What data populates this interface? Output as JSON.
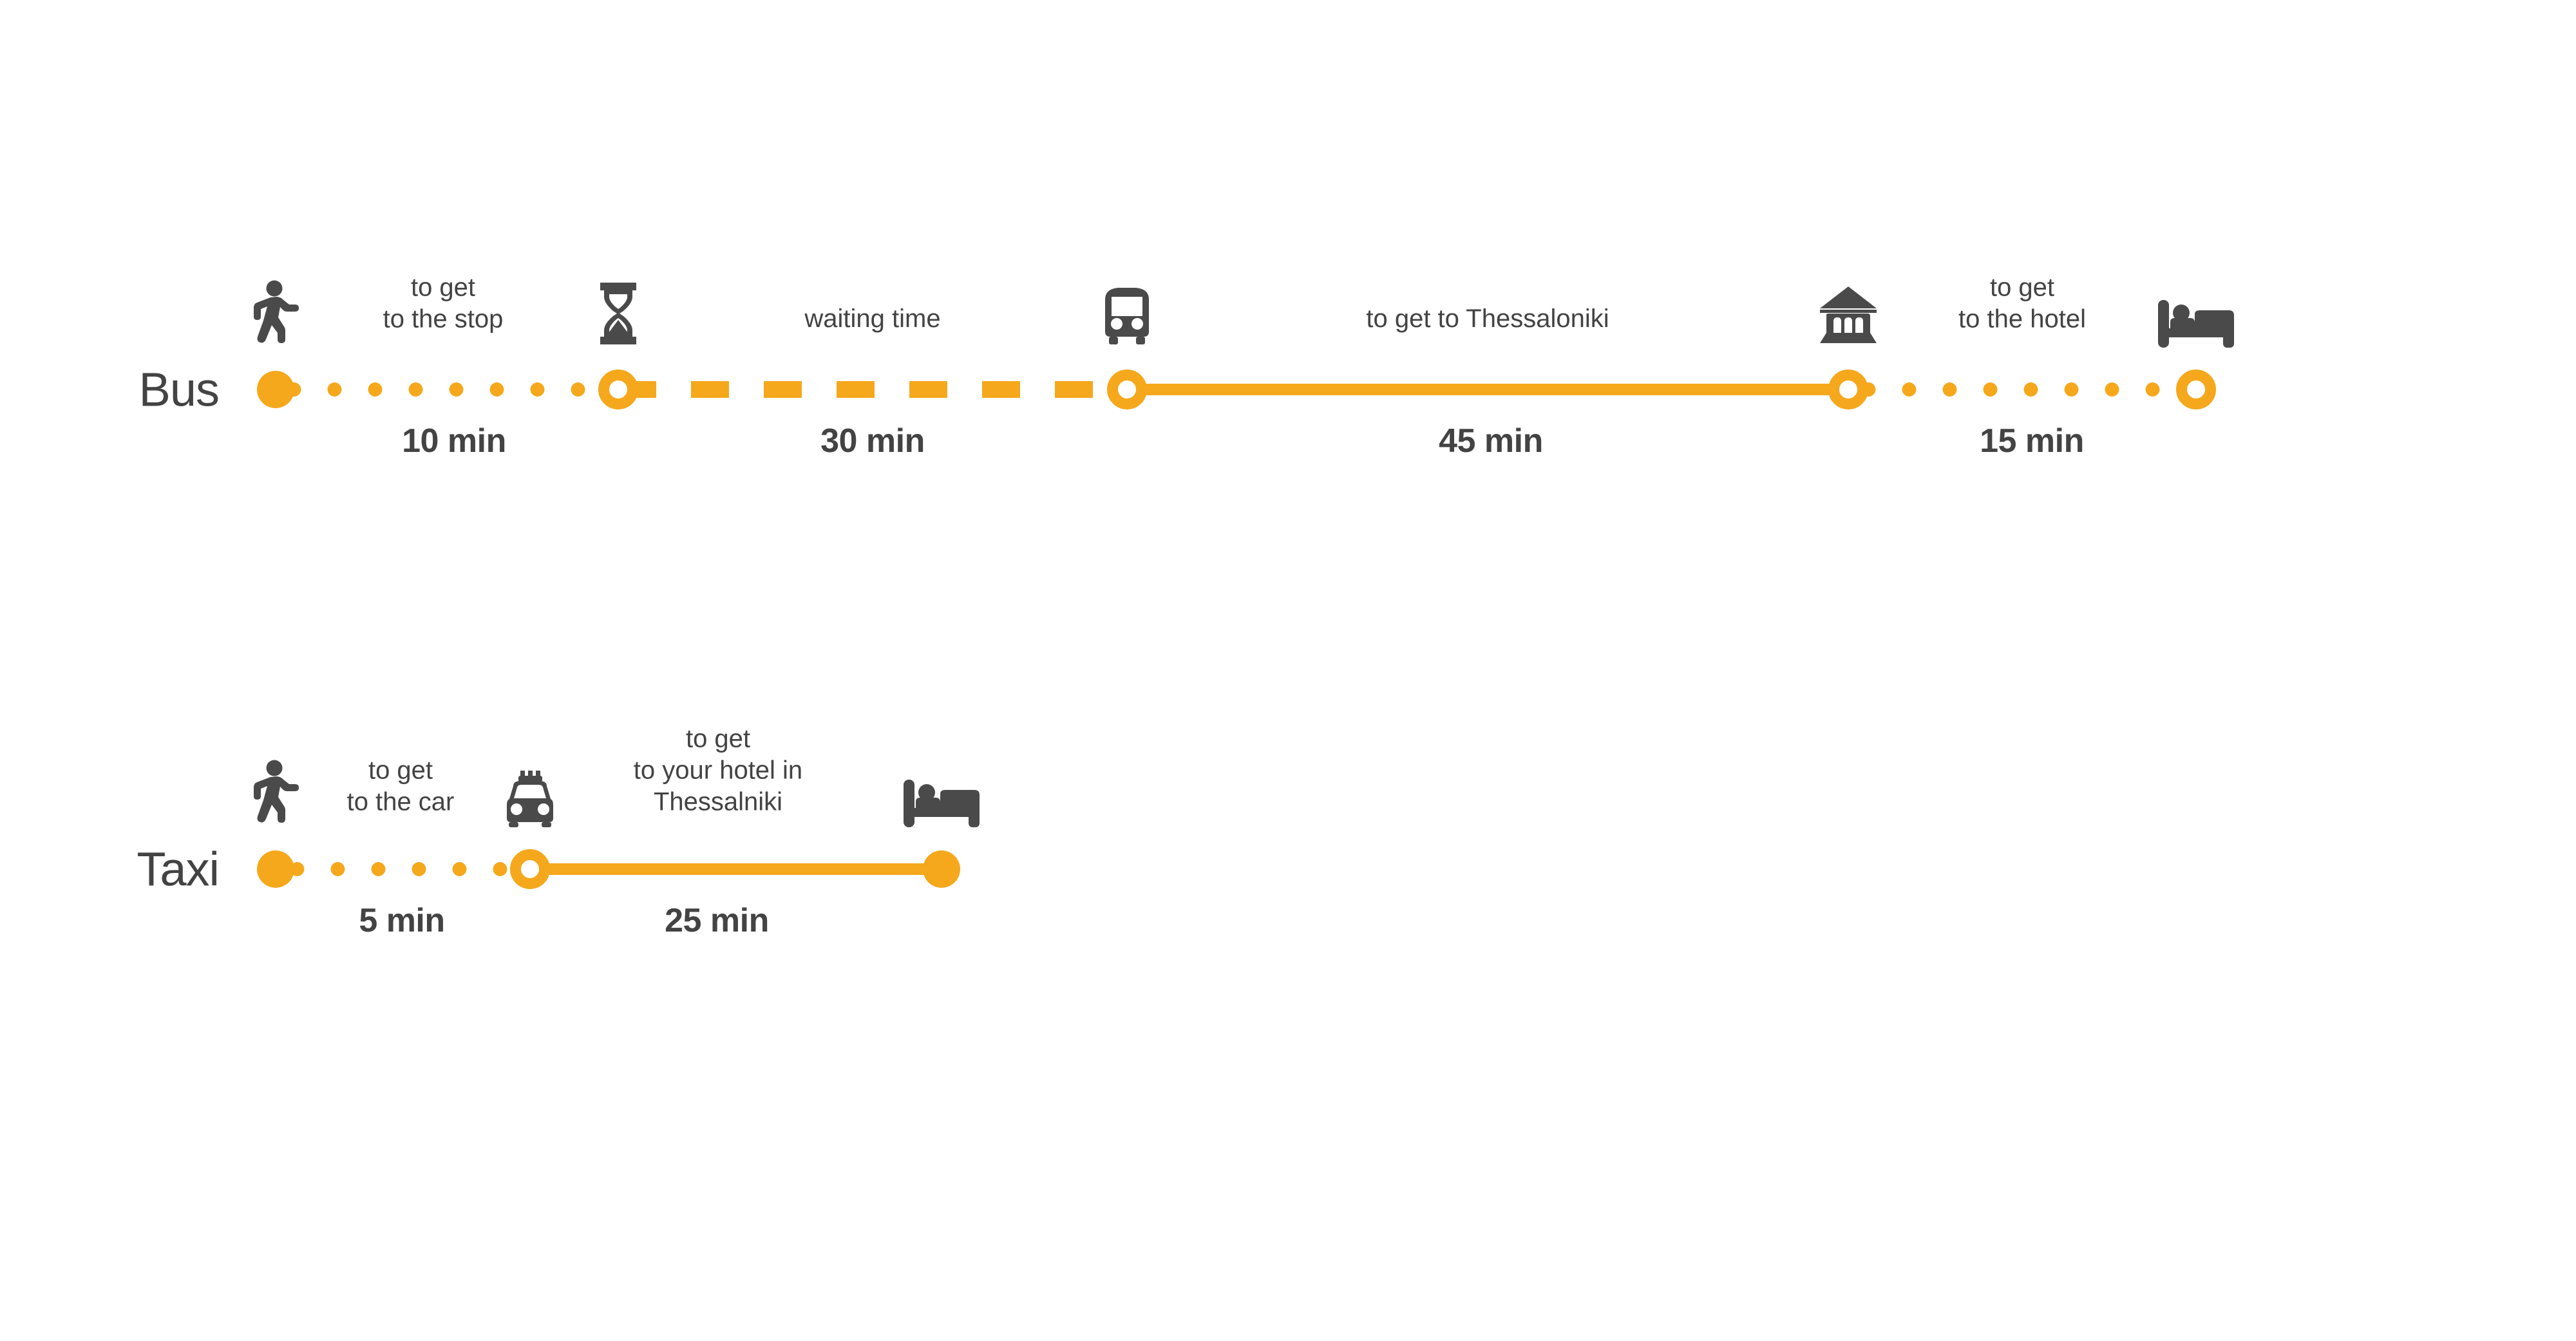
{
  "theme": {
    "accent": "#F5A81C",
    "text": "#434343",
    "background": "#FFFFFF"
  },
  "chart_data": {
    "type": "timeline",
    "title": "",
    "rows": [
      {
        "label": "Bus",
        "total_minutes": 100,
        "segments": [
          {
            "description": "to get\nto the stop",
            "duration": "10 min",
            "minutes": 10,
            "style": "dotted"
          },
          {
            "description": "waiting time",
            "duration": "30 min",
            "minutes": 30,
            "style": "dashed"
          },
          {
            "description": "to get to Thessaloniki",
            "duration": "45 min",
            "minutes": 45,
            "style": "solid"
          },
          {
            "description": "to get\nto the hotel",
            "duration": "15 min",
            "minutes": 15,
            "style": "dotted"
          }
        ],
        "nodes": [
          {
            "icon": "walking-person-icon",
            "fill": "filled"
          },
          {
            "icon": "hourglass-icon",
            "fill": "hollow"
          },
          {
            "icon": "bus-icon",
            "fill": "hollow"
          },
          {
            "icon": "bank-building-icon",
            "fill": "hollow"
          },
          {
            "icon": "bed-icon",
            "fill": "hollow"
          }
        ]
      },
      {
        "label": "Taxi",
        "total_minutes": 30,
        "segments": [
          {
            "description": "to get\nto the car",
            "duration": "5 min",
            "minutes": 5,
            "style": "dotted"
          },
          {
            "description": "to get\nto your hotel in\nThessalniki",
            "duration": "25 min",
            "minutes": 25,
            "style": "solid"
          }
        ],
        "nodes": [
          {
            "icon": "walking-person-icon",
            "fill": "filled"
          },
          {
            "icon": "taxi-icon",
            "fill": "hollow"
          },
          {
            "icon": "bed-icon",
            "fill": "filled"
          }
        ]
      }
    ]
  },
  "bus": {
    "label": "Bus",
    "seg1": {
      "description": "to get\nto the stop",
      "duration": "10 min"
    },
    "seg2": {
      "description": "waiting time",
      "duration": "30 min"
    },
    "seg3": {
      "description": "to get to Thessaloniki",
      "duration": "45 min"
    },
    "seg4": {
      "description": "to get\nto the hotel",
      "duration": "15 min"
    }
  },
  "taxi": {
    "label": "Taxi",
    "seg1": {
      "description": "to get\nto the car",
      "duration": "5 min"
    },
    "seg2": {
      "description": "to get\nto your hotel in\nThessalniki",
      "duration": "25 min"
    }
  }
}
